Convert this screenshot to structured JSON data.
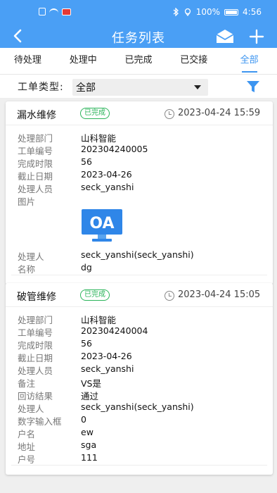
{
  "status_bar": {
    "battery": "100%",
    "time": "4:56"
  },
  "nav": {
    "title": "任务列表"
  },
  "tabs": [
    {
      "label": "待处理"
    },
    {
      "label": "处理中"
    },
    {
      "label": "已完成"
    },
    {
      "label": "已交接"
    },
    {
      "label": "全部",
      "active": true
    }
  ],
  "filter": {
    "label": "工单类型:",
    "selected": "全部"
  },
  "cards": [
    {
      "type": "漏水维修",
      "status": "已完成",
      "datetime": "2023-04-24 15:59",
      "fields": [
        {
          "label": "处理部门",
          "value": "山科智能"
        },
        {
          "label": "工单编号",
          "value": "202304240005"
        },
        {
          "label": "完成时限",
          "value": "56"
        },
        {
          "label": "截止日期",
          "value": "2023-04-26"
        },
        {
          "label": "处理人员",
          "value": "seck_yanshi"
        }
      ],
      "image_label": "图片",
      "image_text": "OA",
      "fields_after": [
        {
          "label": "处理人",
          "value": "seck_yanshi(seck_yanshi)"
        },
        {
          "label": "名称",
          "value": "dg"
        }
      ]
    },
    {
      "type": "破管维修",
      "status": "已完成",
      "datetime": "2023-04-24 15:05",
      "fields": [
        {
          "label": "处理部门",
          "value": "山科智能"
        },
        {
          "label": "工单编号",
          "value": "202304240004"
        },
        {
          "label": "完成时限",
          "value": "56"
        },
        {
          "label": "截止日期",
          "value": "2023-04-26"
        },
        {
          "label": "处理人员",
          "value": "seck_yanshi"
        },
        {
          "label": "备注",
          "value": "VS是"
        },
        {
          "label": "回访结果",
          "value": "通过"
        },
        {
          "label": "处理人",
          "value": "seck_yanshi(seck_yanshi)"
        },
        {
          "label": "数字输入框",
          "value": "0"
        },
        {
          "label": "户名",
          "value": "ew"
        },
        {
          "label": "地址",
          "value": "sga"
        },
        {
          "label": "户号",
          "value": "111"
        }
      ]
    }
  ],
  "colors": {
    "primary": "#4a9ff5",
    "tab_active": "#3d95f0",
    "status_green": "#2bb45a"
  }
}
